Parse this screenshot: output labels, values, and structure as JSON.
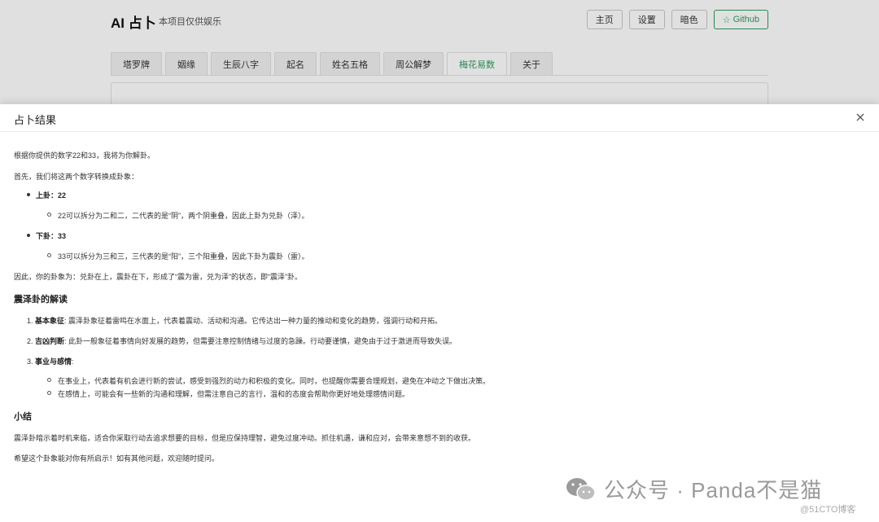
{
  "app": {
    "title": "AI 占卜",
    "subtitle": "本项目仅供娱乐",
    "header_buttons": [
      "主页",
      "设置",
      "暗色",
      "Github"
    ],
    "tabs": [
      "塔罗牌",
      "姻缘",
      "生辰八字",
      "起名",
      "姓名五格",
      "周公解梦",
      "梅花易数",
      "关于"
    ],
    "active_tab": "梅花易数"
  },
  "modal": {
    "title": "占卜结果",
    "intro": "根据你提供的数字22和33，我将为你解卦。",
    "first": "首先，我们将这两个数字转换成卦象：",
    "upper_label": "上卦：22",
    "upper_detail": "22可以拆分为二和二，二代表的是“阴”，两个阴重叠，因此上卦为兑卦（泽）。",
    "lower_label": "下卦：33",
    "lower_detail": "33可以拆分为三和三，三代表的是“阳”，三个阳重叠，因此下卦为震卦（雷）。",
    "therefore": "因此，你的卦象为：兑卦在上，震卦在下，形成了“震为雷，兑为泽”的状态，即“震泽”卦。",
    "section1_title": "震泽卦的解读",
    "item1_num": "1.",
    "item1_label": "基本象征",
    "item1_text": ": 震泽卦象征着雷鸣在水面上，代表着震动、活动和沟通。它传达出一种力量的推动和变化的趋势，强调行动和开拓。",
    "item2_num": "2.",
    "item2_label": "吉凶判断",
    "item2_text": ": 此卦一般象征着事情向好发展的趋势，但需要注意控制情绪与过度的急躁。行动要谨慎，避免由于过于激进而导致失误。",
    "item3_num": "3.",
    "item3_label": "事业与感情",
    "item3_text": ":",
    "career": "在事业上，代表着有机会进行新的尝试，感受到强烈的动力和积极的变化。同时，也提醒你需要合理规划，避免在冲动之下做出决策。",
    "love": "在感情上，可能会有一些新的沟通和理解，但需注意自己的言行，温和的态度会帮助你更好地处理感情问题。",
    "section2_title": "小结",
    "summary": "震泽卦暗示着时机来临，适合你采取行动去追求想要的目标，但是应保持理智，避免过度冲动。抓住机遇，谦和应对，会带来意想不到的收获。",
    "closing": "希望这个卦象能对你有所启示！如有其他问题，欢迎随时提问。"
  },
  "watermark": {
    "text": "公众号 · Panda不是猫",
    "site": "@51CTO博客"
  }
}
